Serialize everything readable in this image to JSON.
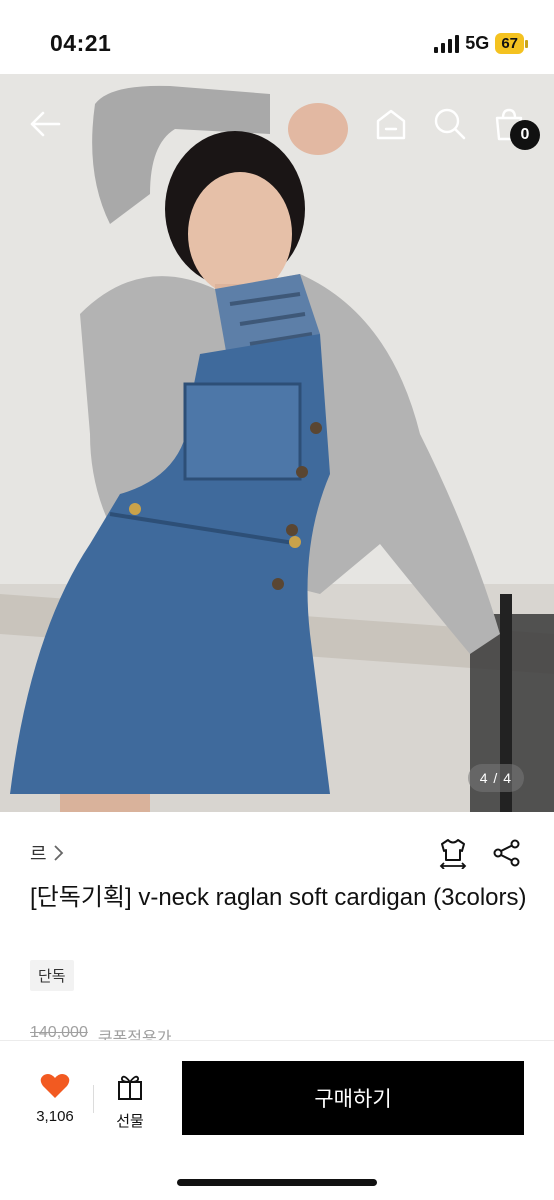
{
  "status_bar": {
    "time": "04:21",
    "network": "5G",
    "battery": "67"
  },
  "hero": {
    "page_indicator": "4 / 4",
    "cart_count": "0"
  },
  "product": {
    "brand": "르",
    "title": "[단독기획] v-neck raglan soft cardigan (3colors)",
    "tag": "단독",
    "price_original": "140,000",
    "price_note": "쿠폰적용가"
  },
  "bottom_bar": {
    "like_count": "3,106",
    "gift_label": "선물",
    "buy_label": "구매하기"
  },
  "colors": {
    "accent": "#f25a21",
    "buy_button": "#000000",
    "battery": "#f4c220"
  },
  "icons": [
    "back-arrow-icon",
    "home-icon",
    "search-icon",
    "cart-icon",
    "try-on-shirt-icon",
    "share-icon",
    "heart-icon",
    "gift-icon",
    "chevron-right-icon"
  ]
}
